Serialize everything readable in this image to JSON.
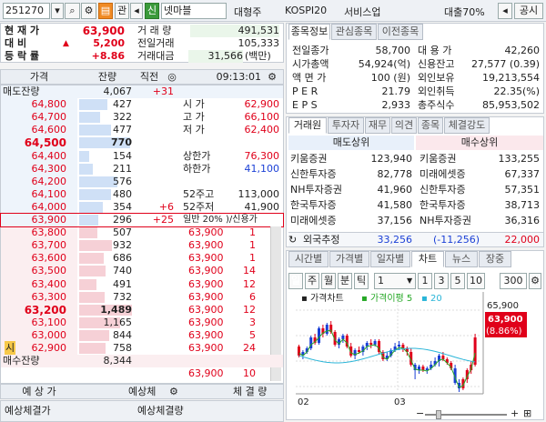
{
  "top": {
    "code": "251270",
    "stock_name": "넷마블",
    "btn_gwan": "관",
    "btn_sin": "신",
    "sector_left": "대형주",
    "sector_mid": "KOSPI20",
    "sector_right": "서비스업",
    "margin": "대출70%",
    "share": "공시"
  },
  "quote": {
    "price_label": "현 재 가",
    "price": "63,900",
    "change_label": "대 비",
    "change": "5,200",
    "rate_label": "등 락 률",
    "rate": "+8.86",
    "vol_label": "거 래 량",
    "vol": "491,531",
    "prev_label": "전일거래",
    "prev": "105,333",
    "amt_label": "거래대금",
    "amt": "31,566",
    "amt_unit": "(백만)"
  },
  "orderbook": {
    "headers": [
      "가격",
      "잔량",
      "직전",
      "09:13:01"
    ],
    "total_ask_label": "매도잔량",
    "total_ask": "4,067",
    "total_ask_chg": "+31",
    "asks": [
      {
        "price": "64,800",
        "qty": "427"
      },
      {
        "price": "64,700",
        "qty": "322"
      },
      {
        "price": "64,600",
        "qty": "477"
      },
      {
        "price": "64,500",
        "qty": "770"
      },
      {
        "price": "64,400",
        "qty": "154"
      },
      {
        "price": "64,300",
        "qty": "211"
      },
      {
        "price": "64,200",
        "qty": "576"
      },
      {
        "price": "64,100",
        "qty": "480"
      },
      {
        "price": "64,000",
        "qty": "354",
        "chg": "+6"
      },
      {
        "price": "63,900",
        "qty": "296",
        "chg": "+25"
      }
    ],
    "bids": [
      {
        "price": "63,800",
        "qty": "507"
      },
      {
        "price": "63,700",
        "qty": "932"
      },
      {
        "price": "63,600",
        "qty": "686"
      },
      {
        "price": "63,500",
        "qty": "740"
      },
      {
        "price": "63,400",
        "qty": "491"
      },
      {
        "price": "63,300",
        "qty": "732"
      },
      {
        "price": "63,200",
        "qty": "1,489"
      },
      {
        "price": "63,100",
        "qty": "1,165"
      },
      {
        "price": "63,000",
        "qty": "844"
      },
      {
        "price": "62,900",
        "qty": "758"
      }
    ],
    "total_bid_label": "매수잔량",
    "total_bid": "8,344",
    "info": [
      {
        "k": "시  가",
        "v": "62,900",
        "c": "red"
      },
      {
        "k": "고  가",
        "v": "66,100",
        "c": "red"
      },
      {
        "k": "저  가",
        "v": "62,400",
        "c": "red"
      },
      {
        "k": "상한가",
        "v": "76,300",
        "c": "red"
      },
      {
        "k": "하한가",
        "v": "41,100",
        "c": "blue"
      },
      {
        "k": "52주고",
        "v": "113,000",
        "c": ""
      },
      {
        "k": "52주저",
        "v": "41,900",
        "c": ""
      }
    ],
    "credit_text": "일반 20% )/신용가",
    "ticks": [
      [
        "63,900",
        "1"
      ],
      [
        "63,900",
        "1"
      ],
      [
        "63,900",
        "1"
      ],
      [
        "63,900",
        "14"
      ],
      [
        "63,900",
        "12"
      ],
      [
        "63,900",
        "6"
      ],
      [
        "63,900",
        "12"
      ],
      [
        "63,900",
        "3"
      ],
      [
        "63,900",
        "5"
      ],
      [
        "63,900",
        "24"
      ],
      [
        "63,900",
        "51"
      ],
      [
        "63,900",
        "10"
      ]
    ],
    "footer_left": "예 상 가",
    "footer_mid": "예상체",
    "footer_right": "체 결 량",
    "bottom_left": "예상체결가",
    "bottom_right": "예상체결량",
    "marker": "시"
  },
  "info_tabs": [
    "종목정보",
    "관심종목",
    "이전종목"
  ],
  "info": {
    "left": [
      [
        "전일종가",
        "58,700"
      ],
      [
        "시가총액",
        "54,924(억)"
      ],
      [
        "액 면 가",
        "100 (원)"
      ],
      [
        "P E R",
        "21.79"
      ],
      [
        "E P S",
        "2,933"
      ]
    ],
    "right": [
      [
        "대 용 가",
        "42,260"
      ],
      [
        "신용잔고",
        "27,577 (0.39)"
      ],
      [
        "외인보유",
        "19,213,554"
      ],
      [
        "외인취득",
        "22.35(%)"
      ],
      [
        "총주식수",
        "85,953,502"
      ]
    ]
  },
  "broker_tabs": [
    "거래원",
    "투자자",
    "재무",
    "의견",
    "종목",
    "체결강도"
  ],
  "broker": {
    "sell_title": "매도상위",
    "buy_title": "매수상위",
    "rows": [
      [
        "키움증권",
        "123,940",
        "키움증권",
        "133,255"
      ],
      [
        "신한투자증",
        "82,778",
        "미래에셋증",
        "67,337"
      ],
      [
        "NH투자증권",
        "41,960",
        "신한투자증",
        "57,351"
      ],
      [
        "한국투자증",
        "41,580",
        "한국투자증",
        "38,713"
      ],
      [
        "미래에셋증",
        "37,156",
        "NH투자증권",
        "36,316"
      ]
    ],
    "foreign_label": "외국추정",
    "foreign_sell": "33,256",
    "foreign_net": "(-11,256)",
    "foreign_buy": "22,000"
  },
  "chart_tabs": [
    "시간별",
    "가격별",
    "일자별",
    "차트",
    "뉴스",
    "장중"
  ],
  "chart_ctrl": {
    "period_d": "일",
    "period_w": "주",
    "period_m": "월",
    "period_min": "분",
    "period_tick": "틱",
    "sel": "1",
    "n1": "1",
    "n3": "3",
    "n5": "5",
    "n10": "10",
    "count": "300"
  },
  "chart": {
    "legend1": "가격차트",
    "legend2": "가격이평",
    "ma1": "5",
    "ma2": "20",
    "price_tag": "63,900",
    "rate_tag": "(8.86%)",
    "x1": "02",
    "x2": "03",
    "yt": "65,900"
  },
  "colors": {
    "up": "#e0001a",
    "down": "#1a3fd6",
    "ma5": "#26a826",
    "ma20": "#2ab5d8"
  }
}
